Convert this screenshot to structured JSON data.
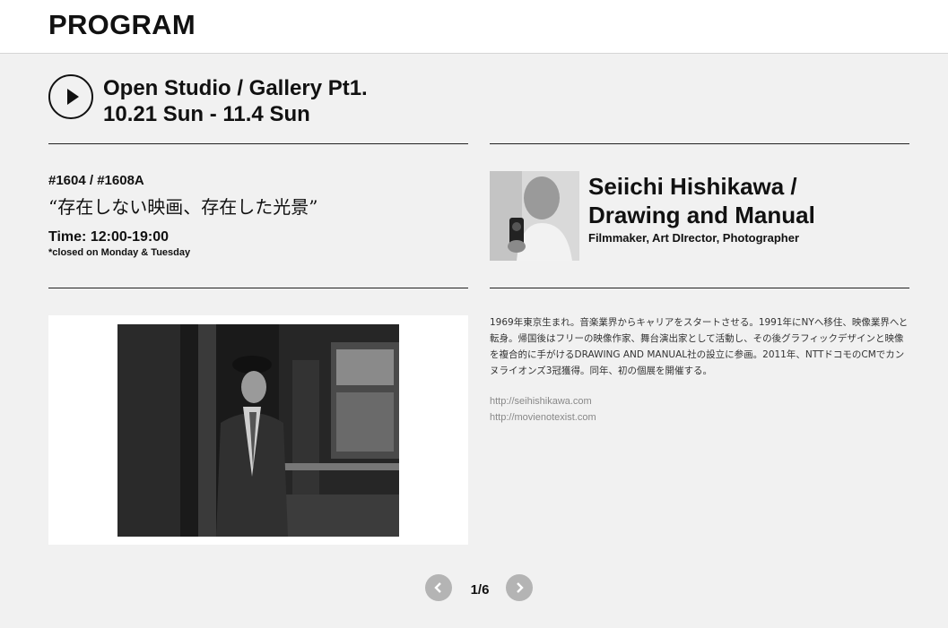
{
  "header": {
    "title": "PROGRAM"
  },
  "program": {
    "title_line1": "Open Studio / Gallery Pt1.",
    "title_line2": "10.21 Sun - 11.4 Sun"
  },
  "work": {
    "rooms": "#1604 / #1608A",
    "title": "“存在しない映画、存在した光景”",
    "time": "Time: 12:00-19:00",
    "closed_note": "*closed on Monday & Tuesday"
  },
  "artist": {
    "name_line1": "Seiichi Hishikawa /",
    "name_line2": "Drawing and Manual",
    "role": "Filmmaker, Art DIrector, Photographer",
    "bio": "1969年東京生まれ。音楽業界からキャリアをスタートさせる。1991年にNYへ移住、映像業界へと転身。帰国後はフリーの映像作家、舞台演出家として活動し、その後グラフィックデザインと映像を複合的に手がけるDRAWING AND MANUAL社の設立に参画。2011年、NTTドコモのCMでカンヌライオンズ3冠獲得。同年、初の個展を開催する。",
    "links": [
      "http://seihishikawa.com",
      "http://movienotexist.com"
    ]
  },
  "pager": {
    "label": "1/6"
  },
  "icons": {
    "play": "play-icon",
    "prev": "chevron-left-icon",
    "next": "chevron-right-icon"
  }
}
